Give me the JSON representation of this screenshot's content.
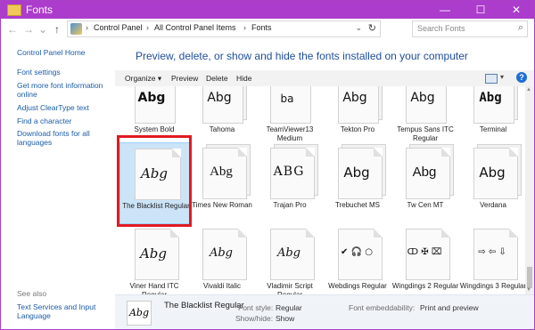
{
  "window": {
    "title": "Fonts",
    "minimize": "—",
    "maximize": "☐",
    "close": "✕"
  },
  "nav": {
    "back": "←",
    "forward": "→",
    "recent": "⌄",
    "up": "↑",
    "sep": "›",
    "path_dropdown": "⌄",
    "refresh": "↻"
  },
  "breadcrumb": [
    "Control Panel",
    "All Control Panel Items",
    "Fonts"
  ],
  "search": {
    "placeholder": "Search Fonts",
    "icon": "search-icon"
  },
  "left_pane": {
    "links": [
      "Control Panel Home",
      "Font settings",
      "Get more font information online",
      "Adjust ClearType text",
      "Find a character",
      "Download fonts for all languages"
    ],
    "see_also_heading": "See also",
    "see_also_links": [
      "Text Services and Input Language"
    ]
  },
  "main": {
    "heading": "Preview, delete, or show and hide the fonts installed on your computer"
  },
  "toolbar": {
    "organize": "Organize ▾",
    "preview": "Preview",
    "delete": "Delete",
    "hide": "Hide",
    "view_menu": "▾",
    "help": "?"
  },
  "fonts": {
    "row1": [
      {
        "name": "System Bold",
        "sample": "Abg"
      },
      {
        "name": "Tahoma",
        "sample": "Abg"
      },
      {
        "name": "TeamViewer13 Medium",
        "sample": "ba"
      },
      {
        "name": "Tekton Pro",
        "sample": "Abg"
      },
      {
        "name": "Tempus Sans ITC Regular",
        "sample": "Abg"
      },
      {
        "name": "Terminal",
        "sample": "Abg"
      }
    ],
    "row2": [
      {
        "name": "The Blacklist Regular",
        "sample": "Abg"
      },
      {
        "name": "Times New Roman",
        "sample": "Abg"
      },
      {
        "name": "Trajan Pro",
        "sample": "ABG"
      },
      {
        "name": "Trebuchet MS",
        "sample": "Abg"
      },
      {
        "name": "Tw Cen MT",
        "sample": "Abg"
      },
      {
        "name": "Verdana",
        "sample": "Abg"
      }
    ],
    "row3": [
      {
        "name": "Viner Hand ITC Regular",
        "sample": "Abg"
      },
      {
        "name": "Vivaldi Italic",
        "sample": "Abg"
      },
      {
        "name": "Vladimir Script Regular",
        "sample": "Abg"
      },
      {
        "name": "Webdings Regular",
        "sample": "✔ 🎧 ○"
      },
      {
        "name": "Wingdings 2 Regular",
        "sample": "ↀ ✠ ⌧"
      },
      {
        "name": "Wingdings 3 Regular",
        "sample": "⇨ ⇦ ⇩"
      }
    ]
  },
  "details": {
    "font_name": "The Blacklist Regular",
    "preview_sample": "Abg",
    "style_label": "Font style:",
    "style_value": "Regular",
    "showhide_label": "Show/hide:",
    "showhide_value": "Show",
    "embed_label": "Font embeddability:",
    "embed_value": "Print and preview"
  },
  "colors": {
    "titlebar": "#ac3ccc",
    "accent_link": "#1a5ca8",
    "heading": "#1f4e9a",
    "selection": "#cce4f7",
    "highlight_box": "#e01a22"
  }
}
